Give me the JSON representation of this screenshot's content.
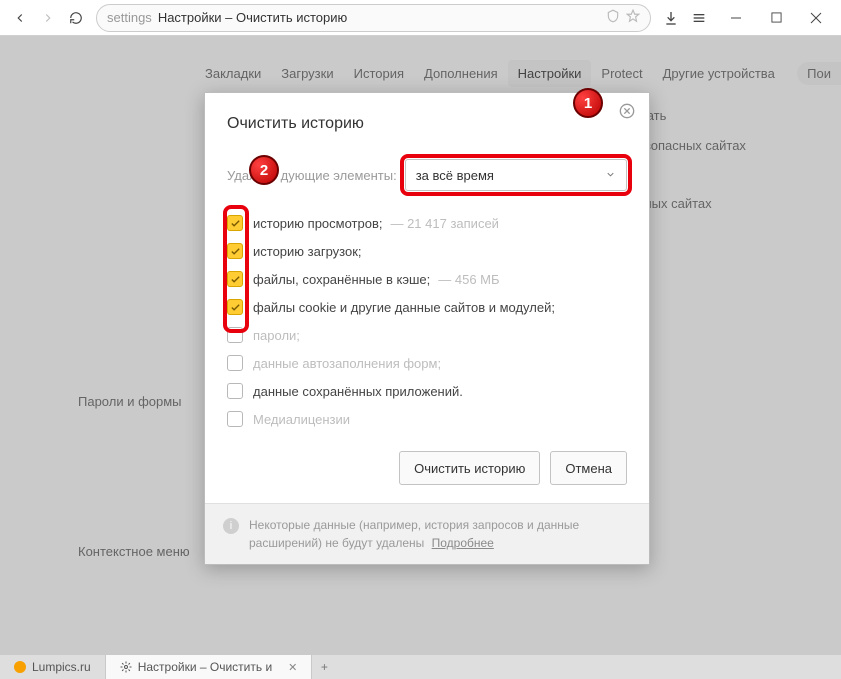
{
  "titlebar": {
    "prefix": "settings",
    "title": "Настройки – Очистить историю"
  },
  "tabs": {
    "items": [
      {
        "label": "Закладки"
      },
      {
        "label": "Загрузки"
      },
      {
        "label": "История"
      },
      {
        "label": "Дополнения"
      },
      {
        "label": "Настройки"
      },
      {
        "label": "Protect"
      },
      {
        "label": "Другие устройства"
      }
    ],
    "search": "Пои"
  },
  "sidebar": {
    "l1": "Пароли и формы",
    "l2": "Контекстное меню"
  },
  "bg": {
    "t1": "жать",
    "t2": "езопасных сайтах",
    "t3": "сных сайтах"
  },
  "dialog": {
    "title": "Очистить историю",
    "callout1": "1",
    "callout2": "2",
    "range_label": "Удалить следующие элементы:",
    "range_label_visible_left": "Удал",
    "range_label_visible_right": "дующие элементы:",
    "range_value": "за всё время",
    "items": [
      {
        "checked": true,
        "label": "историю просмотров;",
        "suffix": "—  21 417 записей"
      },
      {
        "checked": true,
        "label": "историю загрузок;",
        "suffix": ""
      },
      {
        "checked": true,
        "label": "файлы, сохранённые в кэше;",
        "suffix": "—  456 МБ"
      },
      {
        "checked": true,
        "label": "файлы cookie и другие данные сайтов и модулей;",
        "suffix": ""
      },
      {
        "checked": false,
        "label": "пароли;",
        "suffix": ""
      },
      {
        "checked": false,
        "label": "данные автозаполнения форм;",
        "suffix": ""
      },
      {
        "checked": false,
        "label": "данные сохранённых приложений.",
        "suffix": ""
      },
      {
        "checked": false,
        "label": "Медиалицензии",
        "suffix": ""
      }
    ],
    "btn_clear": "Очистить историю",
    "btn_cancel": "Отмена",
    "footer_text": "Некоторые данные (например, история запросов и данные расширений) не будут удалены",
    "footer_link": "Подробнее"
  },
  "taskbar": {
    "t1": "Lumpics.ru",
    "t2": "Настройки – Очистить и"
  }
}
